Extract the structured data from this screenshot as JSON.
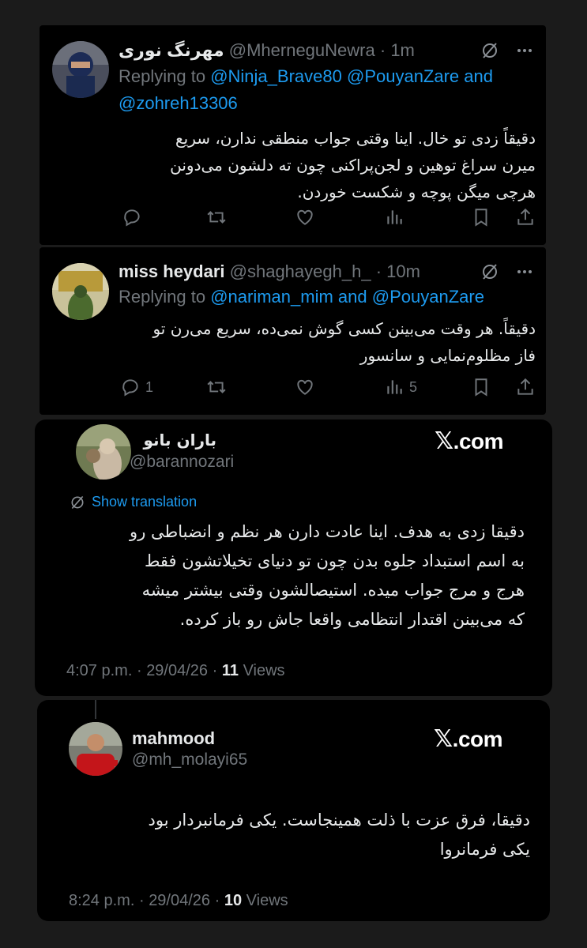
{
  "tweets": [
    {
      "name": "مهرنگ نوری",
      "handle": "@MherneguNewra",
      "dot": "·",
      "time": "1m",
      "replying_prefix": "Replying to",
      "mention1": "@Ninja_Brave80",
      "mention2": "@PouyanZare",
      "and": "and",
      "mention3": "@zohreh13306",
      "text_lines": [
        "دقیقاً زدی تو خال. اینا وقتی جواب منطقی ندارن، سریع",
        "میرن سراغ توهین و لجن‌پراکنی چون ته دلشون می‌دونن",
        "هرچی میگن پوچه و شکست خوردن."
      ]
    },
    {
      "name": "miss heydari",
      "handle": "@shaghayegh_h_",
      "dot": "·",
      "time": "10m",
      "replying_prefix": "Replying to",
      "mention1": "@nariman_mim",
      "and": "and",
      "mention2": "@PouyanZare",
      "text_lines": [
        "دقیقاً. هر وقت می‌بینن کسی گوش نمی‌ده، سریع می‌رن تو",
        "فاز مظلوم‌نمایی و سانسور"
      ],
      "reply_count": "1",
      "views_count": "5"
    }
  ],
  "embeds": [
    {
      "name": "باران بانو",
      "handle": "@barannozari",
      "brand_x": "𝕏",
      "brand_com": ".com",
      "translate": "Show translation",
      "text_lines": [
        "دقیقا زدی به هدف. اینا عادت دارن هر نظم و انضباطی رو",
        "به اسم استبداد جلوه بدن چون تو دنیای تخیلاتشون فقط",
        "هرج و مرج جواب میده. استیصالشون وقتی بیشتر میشه",
        "که می‌بینن اقتدار انتظامی واقعا جاش رو باز کرده."
      ],
      "time": "4:07 p.m.",
      "date": "29/04/26",
      "sep": "·",
      "views_num": "11",
      "views_label": "Views"
    },
    {
      "name": "mahmood",
      "handle": "@mh_molayi65",
      "brand_x": "𝕏",
      "brand_com": ".com",
      "text_lines": [
        "دقیقا، فرق عزت با ذلت همینجاست. یکی فرمانبردار بود",
        "یکی فرمانروا"
      ],
      "time": "8:24 p.m.",
      "date": "29/04/26",
      "sep": "·",
      "views_num": "10",
      "views_label": "Views"
    }
  ],
  "colors": {
    "background": "#1b1b1b",
    "card": "#000000",
    "text": "#e7e9ea",
    "muted": "#71767b",
    "link": "#1d9bf0"
  },
  "icons": [
    "reply-icon",
    "retweet-icon",
    "like-icon",
    "views-icon",
    "bookmark-icon",
    "share-icon",
    "grok-icon",
    "more-icon",
    "translate-icon"
  ]
}
